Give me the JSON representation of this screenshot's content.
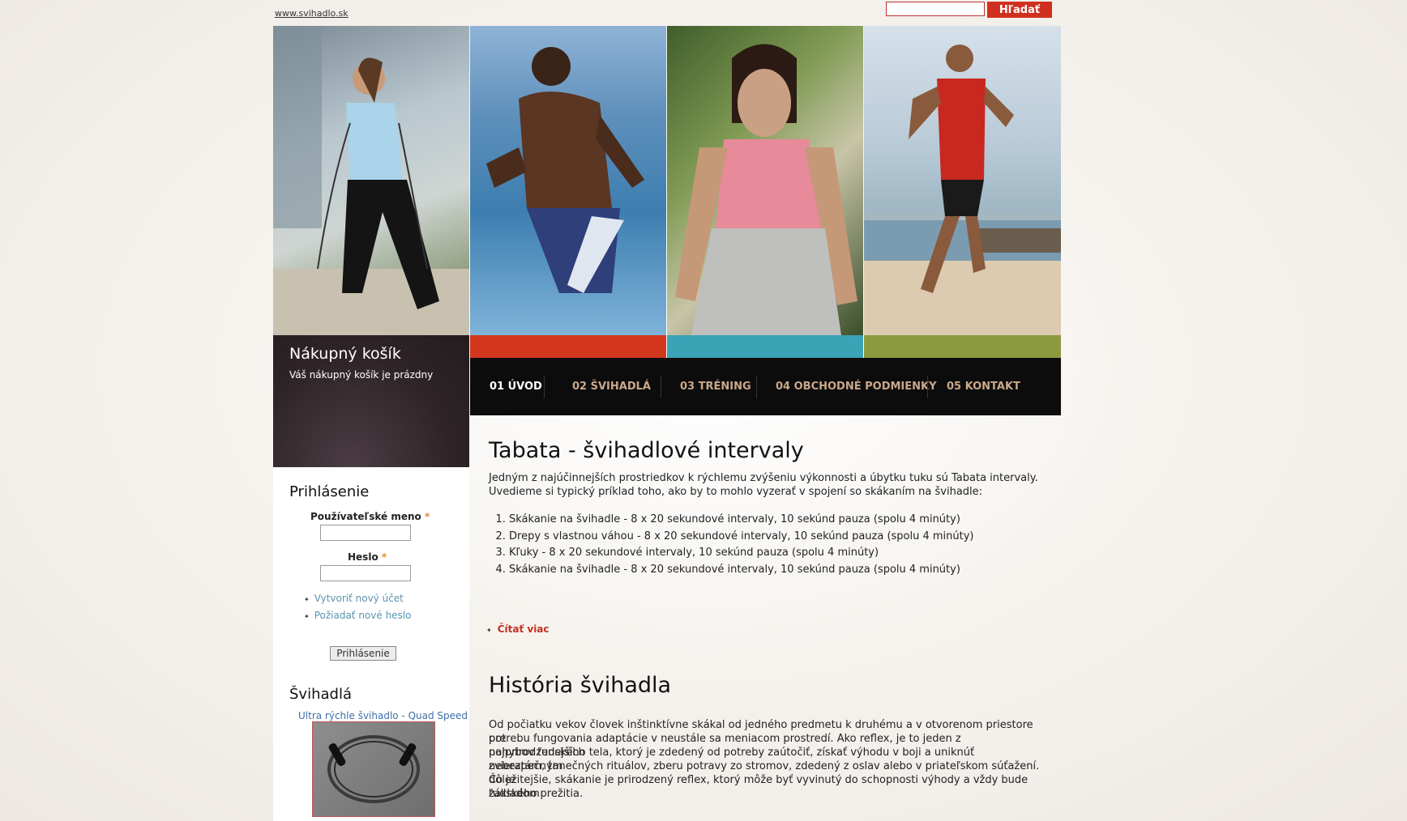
{
  "header": {
    "site_link": "www.svihadlo.sk",
    "search_placeholder": "",
    "search_button": "Hľadať"
  },
  "colors": {
    "accent_red": "#d2361d",
    "accent_teal": "#3aa3b6",
    "accent_olive": "#8c9a3f",
    "nav_bg": "#0c0c0c"
  },
  "nav": {
    "items": [
      {
        "label": "01 ÚVOD"
      },
      {
        "label": "02 ŠVIHADLÁ"
      },
      {
        "label": "03 TRÉNING"
      },
      {
        "label": "04 OBCHODNÉ PODMIENKY"
      },
      {
        "label": "05 KONTAKT"
      }
    ]
  },
  "cart": {
    "title": "Nákupný košík",
    "status": "Váš nákupný košík je prázdny"
  },
  "login": {
    "title": "Prihlásenie",
    "username_label": "Používateľské meno",
    "password_label": "Heslo",
    "required_mark": "*",
    "links": [
      "Vytvoriť nový účet",
      "Požiadať nové heslo"
    ],
    "submit": "Prihlásenie"
  },
  "products": {
    "title": "Švihadlá",
    "item_name": "Ultra rýchle švihadlo - Quad Speed"
  },
  "article1": {
    "title": "Tabata - švihadlové intervaly",
    "intro_line1": "Jedným z najúčinnejších prostriedkov k rýchlemu zvýšeniu výkonnosti a úbytku tuku sú Tabata intervaly.",
    "intro_line2": "Uvedieme si typický príklad toho, ako by to mohlo vyzerať v spojení so skákaním na švihadle:",
    "list": [
      "Skákanie na švihadle - 8 x 20 sekundové intervaly, 10 sekúnd pauza (spolu  4 minúty)",
      "Drepy s vlastnou váhou - 8 x 20 sekundové intervaly, 10 sekúnd pauza (spolu  4 minúty)",
      "Kľuky  - 8 x 20 sekundové intervaly, 10 sekúnd pauza (spolu 4 minúty)",
      "Skákanie na švihadle - 8 x 20 sekundové intervaly, 10 sekúnd pauza (spolu 4 minúty)"
    ],
    "read_more": "Čítať viac"
  },
  "article2": {
    "title": "História švihadla",
    "lines": [
      "Od počiatku vekov človek inštinktívne skákal od jedného predmetu k druhému a  v otvorenom priestore pre",
      "potrebu fungovania adaptácie v neustále sa meniacom prostredí.     Ako reflex, je to jeden z najprirodzenejších",
      "pohybov  ľudského tela, ktorý je zdedený od potreby zaútočiť, získať výhodu v boji a uniknúť nebezpečným",
      "zvieratám, tanečných rituálov, zberu potravy zo stromov, zdedený z oslav alebo v priateľskom súťažení. Čo je",
      "dôležitejšie, skákanie je prirodzený reflex, ktorý môže byť vyvinutý do schopnosti výhody a vždy bude základom",
      " ľudského  prežitia."
    ]
  }
}
